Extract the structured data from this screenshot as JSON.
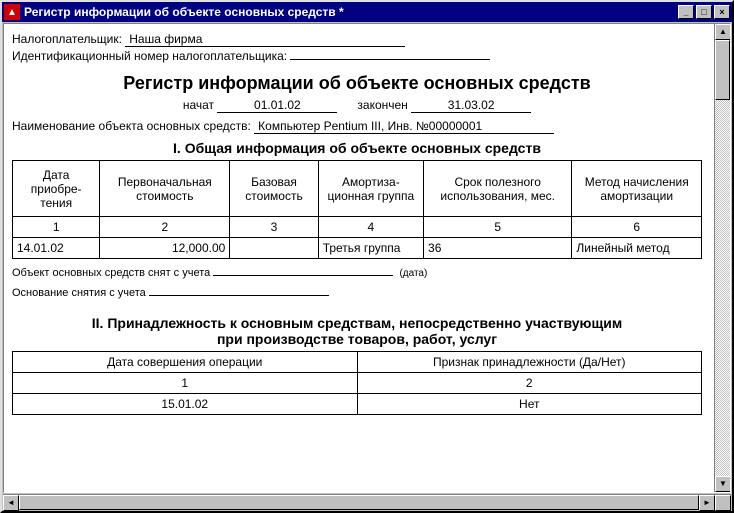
{
  "window": {
    "title": "Регистр информации об объекте основных средств  *"
  },
  "header": {
    "taxpayer_label": "Налогоплательщик:",
    "taxpayer_value": "Наша фирма",
    "tin_label": "Идентификационный номер налогоплательщика:",
    "tin_value": ""
  },
  "main_title": "Регистр информации об объекте основных средств",
  "period": {
    "start_label": "начат",
    "start_value": "01.01.02",
    "end_label": "закончен",
    "end_value": "31.03.02"
  },
  "object": {
    "label": "Наименование объекта основных средств:",
    "value": "Компьютер Pentium III, Инв. №00000001"
  },
  "section1": {
    "title": "I. Общая информация об объекте основных средств",
    "columns": [
      "Дата приобре-тения",
      "Первоначальная стоимость",
      "Базовая стоимость",
      "Амортиза-ционная группа",
      "Срок полезного использования, мес.",
      "Метод начисления амортизации"
    ],
    "numrow": [
      "1",
      "2",
      "3",
      "4",
      "5",
      "6"
    ],
    "data": [
      "14.01.02",
      "12,000.00",
      "",
      "Третья группа",
      "36",
      "Линейный метод"
    ]
  },
  "deregister": {
    "label": "Объект основных средств снят с учета",
    "value": "",
    "date_hint": "(дата)",
    "basis_label": "Основание снятия с учета",
    "basis_value": ""
  },
  "section2": {
    "title_l1": "II. Принадлежность к основным средствам, непосредственно участвующим",
    "title_l2": "при производстве товаров, работ, услуг",
    "columns": [
      "Дата совершения операции",
      "Признак принадлежности (Да/Нет)"
    ],
    "numrow": [
      "1",
      "2"
    ],
    "data": [
      "15.01.02",
      "Нет"
    ]
  }
}
